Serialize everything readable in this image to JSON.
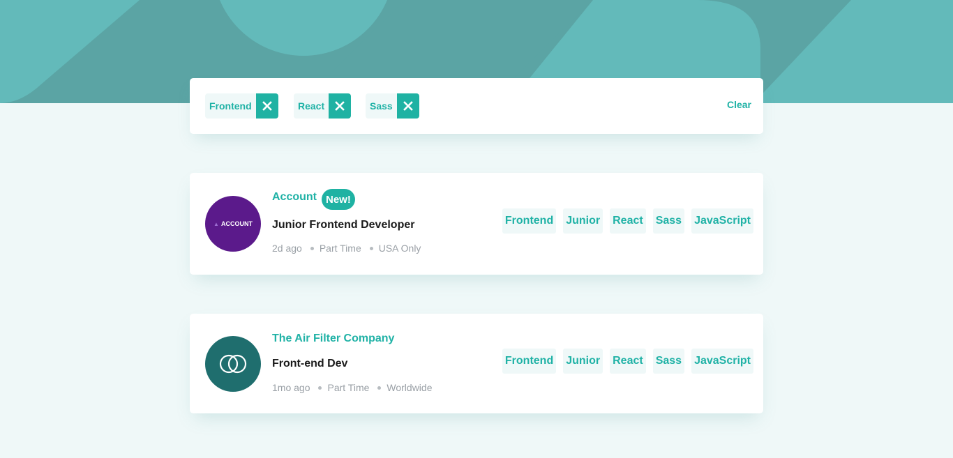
{
  "colors": {
    "primary": "#5ba4a4",
    "accent": "#1fb2a3",
    "background": "#eff8f8",
    "account_logo": "#5b1a8b",
    "airfilter_logo": "#1f6e6e"
  },
  "filter_bar": {
    "filters": [
      {
        "label": "Frontend",
        "remove_icon": "close-icon"
      },
      {
        "label": "React",
        "remove_icon": "close-icon"
      },
      {
        "label": "Sass",
        "remove_icon": "close-icon"
      }
    ],
    "clear_label": "Clear"
  },
  "jobs": [
    {
      "company": "Account",
      "badge": "New!",
      "position": "Junior Frontend Developer",
      "posted": "2d ago",
      "contract": "Part Time",
      "location": "USA Only",
      "logo_text": "ACCOUNT",
      "tags": [
        "Frontend",
        "Junior",
        "React",
        "Sass",
        "JavaScript"
      ]
    },
    {
      "company": "The Air Filter Company",
      "position": "Front-end Dev",
      "posted": "1mo ago",
      "contract": "Part Time",
      "location": "Worldwide",
      "logo_icon": "interlocking-rings-icon",
      "tags": [
        "Frontend",
        "Junior",
        "React",
        "Sass",
        "JavaScript"
      ]
    }
  ]
}
